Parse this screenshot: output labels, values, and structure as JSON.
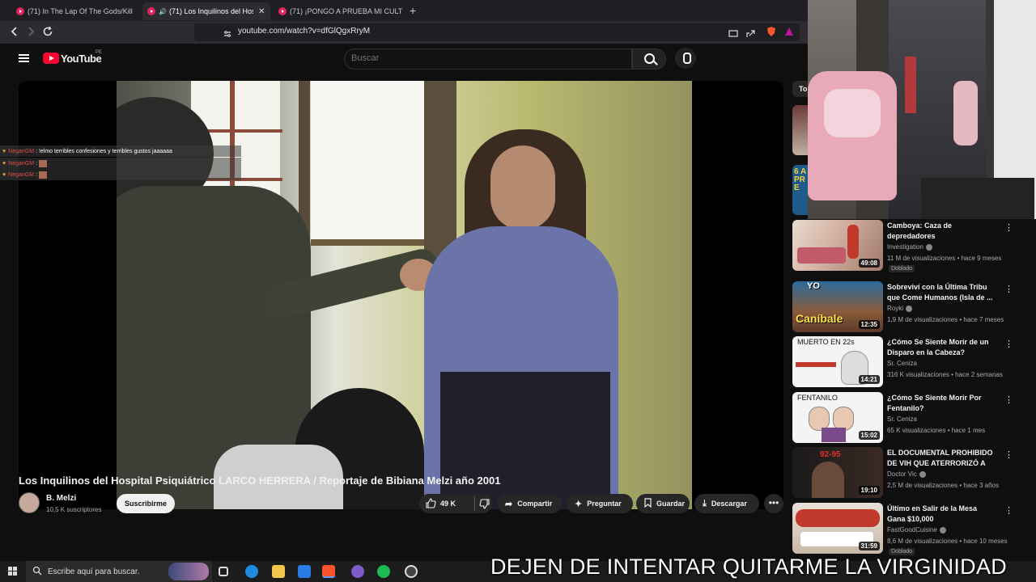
{
  "browser": {
    "tabs": [
      {
        "label": "(71) In The Lap Of The Gods/Killer Q",
        "active": false
      },
      {
        "label": "(71) Los Inquilinos del Hospit",
        "active": true
      },
      {
        "label": "(71) ¡PONGO A PRUEBA MI CULTURA",
        "active": false
      }
    ],
    "new_tab": "+",
    "close": "✕",
    "url": "youtube.com/watch?v=dfGlQgxRryM"
  },
  "youtube": {
    "logo_text": "YouTube",
    "region": "PE",
    "search_placeholder": "Buscar"
  },
  "chat_overlay": [
    {
      "user": "NeganGM",
      "message": ": !elmo terribles confesiones y terribles gustos jaaaaaa",
      "emote": false
    },
    {
      "user": "NeganGM",
      "message": ":",
      "emote": true
    },
    {
      "user": "NeganGM",
      "message": ":",
      "emote": true
    }
  ],
  "video": {
    "title": "Los Inquilinos del Hospital Psiquiátrico LARCO HERRERA / Reportaje de Bibiana Melzi año 2001",
    "channel": "B. Melzi",
    "subscribers": "10,5 K suscriptores",
    "subscribe_label": "Suscribirme",
    "likes": "49 K",
    "share_label": "Compartir",
    "ask_label": "Preguntar",
    "save_label": "Guardar",
    "download_label": "Descargar",
    "more_label": "•••"
  },
  "recommendations": [
    {
      "title": "Camboya: Caza de depredadores",
      "channel": "Investigation",
      "verified": true,
      "meta": "11 M de visualizaciones • hace 9 meses",
      "duration": "49:08",
      "badge": "Doblado"
    },
    {
      "title": "Sobreviví con la Última Tribu que Come Humanos (Isla de ...",
      "channel": "Royki",
      "verified": true,
      "meta": "1,9 M de visualizaciones • hace 7 meses",
      "duration": "12:35",
      "badge": ""
    },
    {
      "title": "¿Cómo Se Siente Morir de un Disparo en la Cabeza?",
      "channel": "Sr. Ceniza",
      "verified": false,
      "meta": "316 K visualizaciones • hace 2 semanas",
      "duration": "14:21",
      "badge": ""
    },
    {
      "title": "¿Cómo Se Siente Morir Por Fentanilo?",
      "channel": "Sr. Ceniza",
      "verified": false,
      "meta": "65 K visualizaciones • hace 1 mes",
      "duration": "15:02",
      "badge": ""
    },
    {
      "title": "EL DOCUMENTAL PROHIBIDO DE VIH QUE ATERRORIZÓ A L...",
      "channel": "Doctor Vic",
      "verified": true,
      "meta": "2,5 M de visualizaciones • hace 3 años",
      "duration": "19:10",
      "badge": ""
    },
    {
      "title": "Último en Salir de la Mesa Gana $10,000",
      "channel": "FastGoodCuisine",
      "verified": true,
      "meta": "8,6 M de visualizaciones • hace 10 meses",
      "duration": "31:59",
      "badge": "Doblado"
    }
  ],
  "thumb_texts": {
    "cannibal_yo": "YO",
    "cannibal_word": "Caníbale",
    "muerto": "MUERTO EN 22s",
    "fentanilo": "FENTANILO",
    "vih_numbers": "92-95",
    "top_partial_tab": "To",
    "side_partial": "6 A PR E"
  },
  "taskbar": {
    "search_placeholder": "Escribe aquí para buscar."
  },
  "stream_marquee": "DEJEN DE INTENTAR QUITARME LA VIRGINIDAD",
  "colors": {
    "youtube_red": "#ff0033",
    "chat_user": "#e54b4b",
    "background": "#0f0f0f"
  },
  "icons": {
    "back": "chevron-left-icon",
    "forward": "chevron-right-icon",
    "reload": "reload-icon",
    "bookmark": "bookmark-icon",
    "like": "thumbs-up-icon",
    "dislike": "thumbs-down-icon",
    "share": "share-icon",
    "ask": "sparkle-icon",
    "save": "bookmark-icon",
    "download": "download-icon"
  }
}
